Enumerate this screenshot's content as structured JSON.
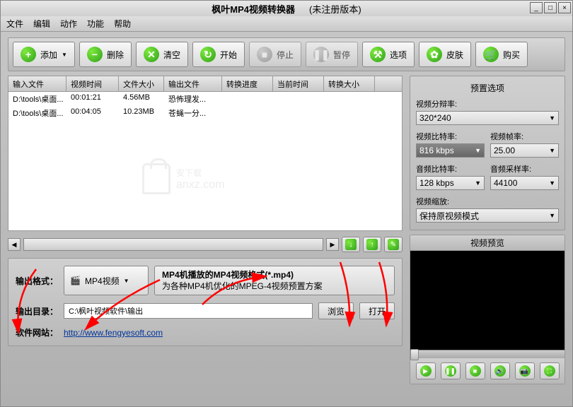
{
  "title": "枫叶MP4视频转换器",
  "registration": "(未注册版本)",
  "menu": [
    "文件",
    "编辑",
    "动作",
    "功能",
    "帮助"
  ],
  "toolbar": {
    "add": "添加",
    "delete": "删除",
    "clear": "清空",
    "start": "开始",
    "stop": "停止",
    "pause": "暂停",
    "options": "选项",
    "skin": "皮肤",
    "buy": "购买"
  },
  "table": {
    "headers": [
      "输入文件",
      "视频时间",
      "文件大小",
      "输出文件",
      "转换进度",
      "当前时间",
      "转换大小"
    ],
    "rows": [
      {
        "input": "D:\\tools\\桌面...",
        "duration": "00:01:21",
        "size": "4.56MB",
        "output": "恐怖理发..."
      },
      {
        "input": "D:\\tools\\桌面...",
        "duration": "00:04:05",
        "size": "10.23MB",
        "output": "苍蝇一分..."
      }
    ]
  },
  "output": {
    "format_label": "输出格式：",
    "format_name": "MP4视频",
    "format_title": "MP4机播放的MP4视频格式(*.mp4)",
    "format_desc": "为各种MP4机优化的MPEG-4视频预置方案",
    "dir_label": "输出目录：",
    "dir_value": "C:\\枫叶视频软件\\输出",
    "browse": "浏览",
    "open": "打开",
    "site_label": "软件网站：",
    "site_url": "http://www.fengyesoft.com"
  },
  "presets": {
    "title": "预置选项",
    "resolution_label": "视频分辩率:",
    "resolution": "320*240",
    "vbitrate_label": "视频比特率:",
    "vbitrate": "816 kbps",
    "fps_label": "视频帧率:",
    "fps": "25.00",
    "abitrate_label": "音频比特率:",
    "abitrate": "128 kbps",
    "asample_label": "音频采样率:",
    "asample": "44100",
    "scale_label": "视频缩放:",
    "scale": "保持原视频模式"
  },
  "preview": {
    "title": "视频预览"
  },
  "watermark": {
    "text": "安下载",
    "sub": "anxz.com"
  }
}
